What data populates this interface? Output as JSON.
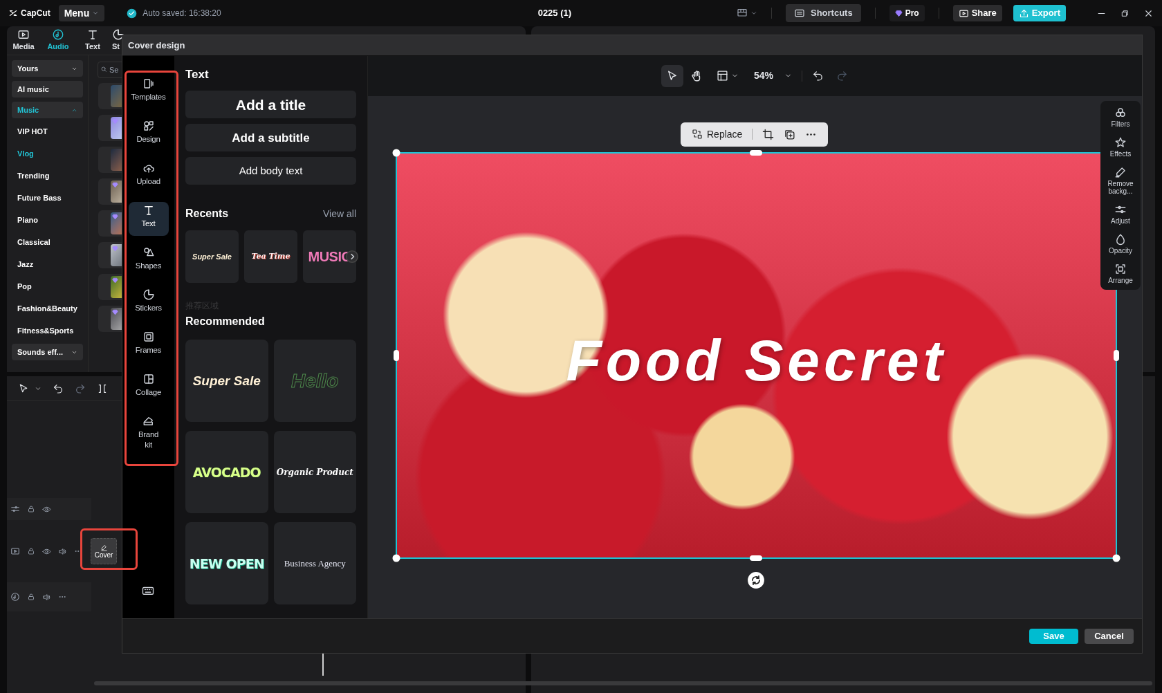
{
  "app": {
    "logo": "CapCut",
    "menu": "Menu",
    "autosave": "Auto saved: 16:38:20",
    "project_title": "0225 (1)",
    "shortcuts": "Shortcuts",
    "pro": "Pro",
    "share": "Share",
    "export": "Export"
  },
  "toolbar_tabs": [
    {
      "label": "Media",
      "selected": false
    },
    {
      "label": "Audio",
      "selected": true
    },
    {
      "label": "Text",
      "selected": false
    },
    {
      "label": "St",
      "selected": false
    }
  ],
  "audio_categories": [
    {
      "label": "Yours",
      "kind": "dropdown",
      "selected": false,
      "expanded": false
    },
    {
      "label": "AI music",
      "kind": "button",
      "selected": false
    },
    {
      "label": "Music",
      "kind": "dropdown",
      "selected": true,
      "expanded": true
    },
    {
      "label": "VIP HOT",
      "kind": "item",
      "selected": false
    },
    {
      "label": "Vlog",
      "kind": "item",
      "selected": true
    },
    {
      "label": "Trending",
      "kind": "item",
      "selected": false
    },
    {
      "label": "Future Bass",
      "kind": "item",
      "selected": false
    },
    {
      "label": "Piano",
      "kind": "item",
      "selected": false
    },
    {
      "label": "Classical",
      "kind": "item",
      "selected": false
    },
    {
      "label": "Jazz",
      "kind": "item",
      "selected": false
    },
    {
      "label": "Pop",
      "kind": "item",
      "selected": false
    },
    {
      "label": "Fashion&Beauty",
      "kind": "item",
      "selected": false
    },
    {
      "label": "Fitness&Sports",
      "kind": "item",
      "selected": false
    },
    {
      "label": "Sounds eff...",
      "kind": "dropdown",
      "selected": false,
      "expanded": false
    }
  ],
  "search": {
    "placeholder": "Se"
  },
  "music_thumbnails": [
    {
      "premium": false
    },
    {
      "premium": true
    },
    {
      "premium": false
    },
    {
      "premium": true
    },
    {
      "premium": true
    },
    {
      "premium": true
    },
    {
      "premium": true
    },
    {
      "premium": true
    }
  ],
  "timeline": {
    "tracks": [
      {
        "kind": "adjust"
      },
      {
        "kind": "video",
        "cover": "Cover"
      },
      {
        "kind": "audio"
      }
    ]
  },
  "dialog": {
    "title": "Cover design",
    "nav": [
      {
        "label": "Templates",
        "selected": false
      },
      {
        "label": "Design",
        "selected": false
      },
      {
        "label": "Upload",
        "selected": false
      },
      {
        "label": "Text",
        "selected": true
      },
      {
        "label": "Shapes",
        "selected": false
      },
      {
        "label": "Stickers",
        "selected": false
      },
      {
        "label": "Frames",
        "selected": false
      },
      {
        "label": "Collage",
        "selected": false
      },
      {
        "label": "Brand kit",
        "selected": false
      }
    ],
    "panel": {
      "heading": "Text",
      "add_buttons": [
        {
          "label": "Add a title",
          "kind": "title"
        },
        {
          "label": "Add a subtitle",
          "kind": "subtitle"
        },
        {
          "label": "Add body text",
          "kind": "body"
        }
      ],
      "recents_heading": "Recents",
      "view_all": "View all",
      "recents": [
        {
          "text": "Super Sale",
          "kind": "sale"
        },
        {
          "text": "Tea Time",
          "kind": "tea"
        },
        {
          "text": "MUSIC",
          "kind": "music"
        }
      ],
      "region_label": "推荐区域",
      "recommended_heading": "Recommended",
      "recommended": [
        {
          "text": "Super Sale",
          "kind": "sale"
        },
        {
          "text": "Hello",
          "kind": "outline"
        },
        {
          "text": "AVOCADO",
          "kind": "avocado"
        },
        {
          "text": "Organic Product",
          "kind": "script"
        },
        {
          "text": "NEW OPEN",
          "kind": "newopen"
        },
        {
          "text": "Business Agency",
          "kind": "serif"
        }
      ]
    },
    "canvas": {
      "zoom": "54%",
      "replace": "Replace",
      "cover_text": "Food Secret"
    },
    "tools": [
      "Filters",
      "Effects",
      "Remove backg...",
      "Adjust",
      "Opacity",
      "Arrange"
    ],
    "save": "Save",
    "cancel": "Cancel"
  }
}
